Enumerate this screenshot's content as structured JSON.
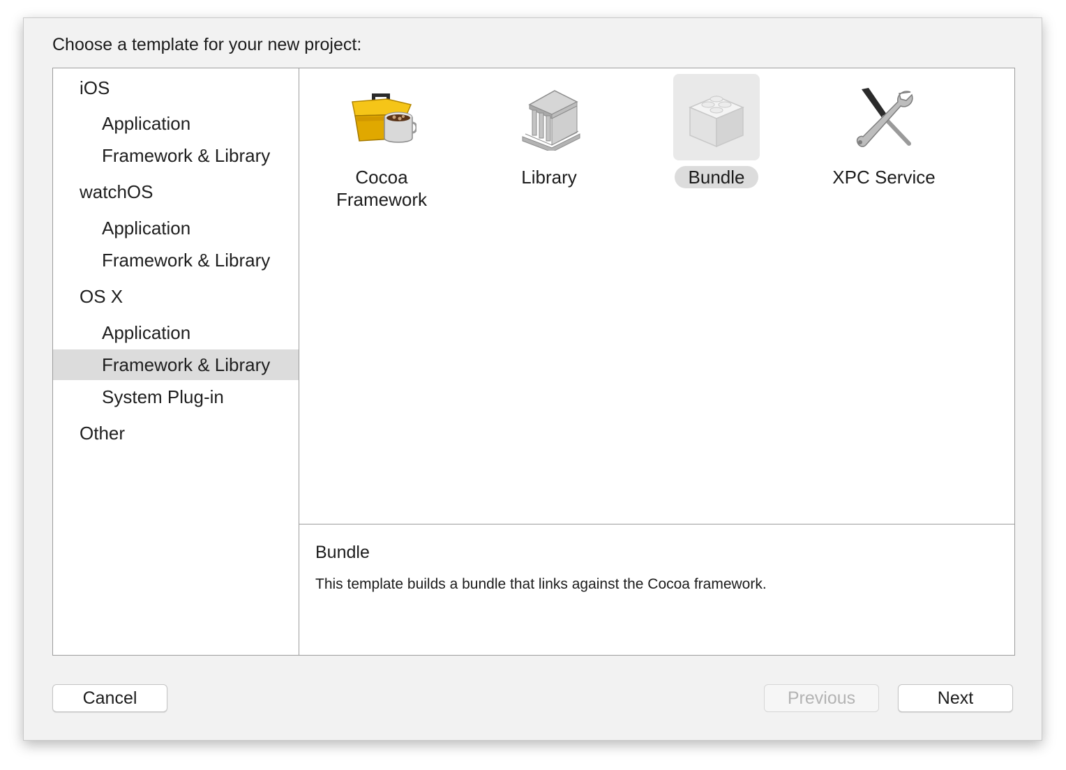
{
  "header": {
    "prompt": "Choose a template for your new project:"
  },
  "sidebar": {
    "groups": [
      {
        "label": "iOS",
        "items": [
          "Application",
          "Framework & Library"
        ]
      },
      {
        "label": "watchOS",
        "items": [
          "Application",
          "Framework & Library"
        ]
      },
      {
        "label": "OS X",
        "items": [
          "Application",
          "Framework & Library",
          "System Plug-in"
        ]
      },
      {
        "label": "Other",
        "items": []
      }
    ],
    "selected": "OS X / Framework & Library"
  },
  "templates": [
    {
      "label_line1": "Cocoa",
      "label_line2": "Framework",
      "icon": "toolbox-icon"
    },
    {
      "label": "Library",
      "icon": "library-building-icon"
    },
    {
      "label": "Bundle",
      "icon": "lego-brick-icon",
      "selected": true
    },
    {
      "label": "XPC Service",
      "icon": "tools-icon"
    }
  ],
  "description": {
    "title": "Bundle",
    "text": "This template builds a bundle that links against the Cocoa framework."
  },
  "buttons": {
    "cancel": "Cancel",
    "previous": "Previous",
    "next": "Next"
  },
  "colors": {
    "selection": "#dcdcdc",
    "sheet_background": "#f2f2f2",
    "disabled_text": "#b3b3b3"
  }
}
